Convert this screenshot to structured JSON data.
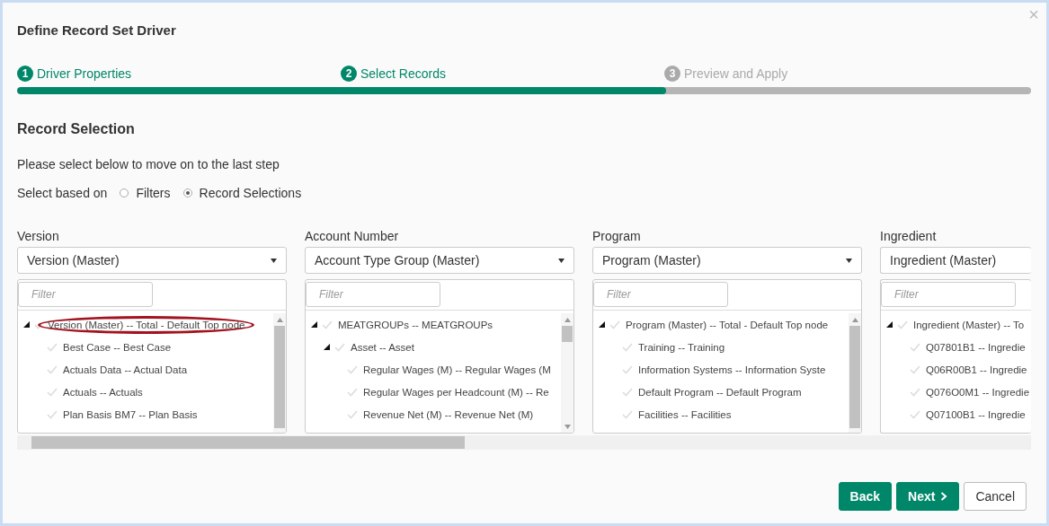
{
  "dialog": {
    "title": "Define Record Set Driver",
    "close": "×"
  },
  "steps": [
    {
      "number": "1",
      "label": "Driver Properties",
      "active": true
    },
    {
      "number": "2",
      "label": "Select Records",
      "active": true
    },
    {
      "number": "3",
      "label": "Preview and Apply",
      "active": false
    }
  ],
  "progress": {
    "level": 0.64
  },
  "section_title": "Record Selection",
  "instruction": "Please select below to move on to the last step",
  "select_based_on": {
    "label": "Select based on",
    "options": [
      {
        "label": "Filters",
        "selected": false
      },
      {
        "label": "Record Selections",
        "selected": true
      }
    ]
  },
  "columns": [
    {
      "label": "Version",
      "dropdown": "Version (Master)",
      "filter_placeholder": "Filter",
      "tree": [
        {
          "label": "Version (Master) -- Total - Default Top node",
          "expanded": true,
          "annotated": true,
          "children": [
            {
              "label": "Best Case -- Best Case"
            },
            {
              "label": "Actuals Data -- Actual Data"
            },
            {
              "label": "Actuals -- Actuals"
            },
            {
              "label": "Plan Basis BM7 -- Plan Basis"
            }
          ]
        }
      ]
    },
    {
      "label": "Account Number",
      "dropdown": "Account Type Group (Master)",
      "filter_placeholder": "Filter",
      "tree": [
        {
          "label": "MEATGROUPs -- MEATGROUPs",
          "expanded": true,
          "children": [
            {
              "label": "Asset -- Asset",
              "expanded": true,
              "children": [
                {
                  "label": "Regular Wages (M) -- Regular Wages (M"
                },
                {
                  "label": "Regular Wages per Headcount (M) -- Re"
                },
                {
                  "label": "Revenue Net (M) -- Revenue Net (M)"
                }
              ]
            }
          ]
        }
      ]
    },
    {
      "label": "Program",
      "dropdown": "Program (Master)",
      "filter_placeholder": "Filter",
      "tree": [
        {
          "label": "Program (Master) -- Total - Default Top node",
          "expanded": true,
          "children": [
            {
              "label": "Training -- Training"
            },
            {
              "label": "Information Systems -- Information Syste"
            },
            {
              "label": "Default Program -- Default Program"
            },
            {
              "label": "Facilities -- Facilities"
            }
          ]
        }
      ]
    },
    {
      "label": "Ingredient",
      "dropdown": "Ingredient (Master)",
      "filter_placeholder": "Filter",
      "tree": [
        {
          "label": "Ingredient (Master) -- To",
          "expanded": true,
          "children": [
            {
              "label": "Q07801B1 -- Ingredie"
            },
            {
              "label": "Q06R00B1 -- Ingredie"
            },
            {
              "label": "Q076O0M1 -- Ingredie"
            },
            {
              "label": "Q07100B1 -- Ingredie"
            }
          ]
        }
      ]
    }
  ],
  "buttons": [
    {
      "label": "Back",
      "kind": "primary"
    },
    {
      "label": "Next",
      "kind": "next"
    },
    {
      "label": "Cancel",
      "kind": "secondary"
    }
  ]
}
